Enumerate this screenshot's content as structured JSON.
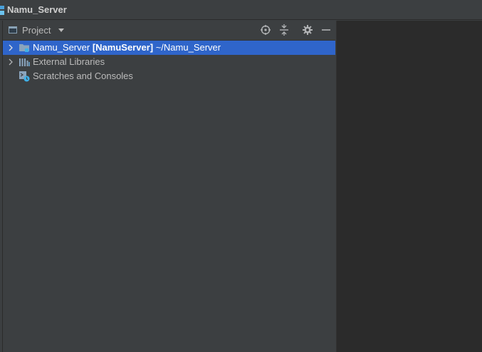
{
  "window": {
    "title": "Namu_Server"
  },
  "panel": {
    "view_label": "Project",
    "tools": [
      "locate-icon",
      "collapse-all-icon",
      "gear-icon",
      "minimize-icon"
    ]
  },
  "tree": {
    "items": [
      {
        "name": "Namu_Server",
        "module": "[NamuServer]",
        "path": "~/Namu_Server",
        "icon": "folder-icon",
        "selected": true
      },
      {
        "name": "External Libraries",
        "icon": "libraries-icon",
        "selected": false
      },
      {
        "name": "Scratches and Consoles",
        "icon": "scratches-icon",
        "selected": false
      }
    ]
  },
  "colors": {
    "background": "#3c3f41",
    "editor_background": "#2b2b2b",
    "selection": "#2f65ca",
    "text": "#bbbbbb"
  }
}
